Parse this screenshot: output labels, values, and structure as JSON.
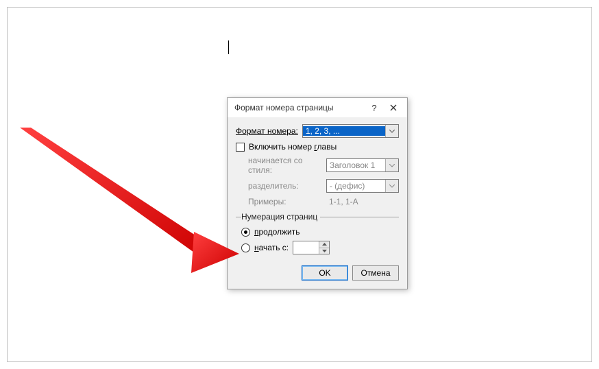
{
  "dialog": {
    "title": "Формат номера страницы",
    "help": "?",
    "format_label": "Формат номера:",
    "format_value": "1, 2, 3, ...",
    "include_chapter_label": "Включить номер главы",
    "starts_with_style_label": "начинается со стиля:",
    "starts_with_style_value": "Заголовок 1",
    "separator_label": "разделитель:",
    "separator_value": "-   (дефис)",
    "examples_label": "Примеры:",
    "examples_value": "1-1, 1-A",
    "numbering_legend": "Нумерация страниц",
    "continue_label": "продолжить",
    "start_at_label": "начать с:",
    "start_at_value": "",
    "ok": "OK",
    "cancel": "Отмена"
  }
}
